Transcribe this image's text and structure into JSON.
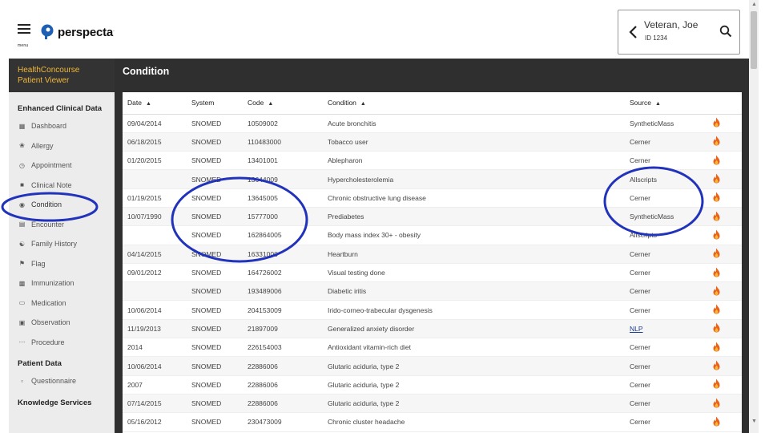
{
  "header": {
    "menu_label": "menu",
    "logo_text": "perspecta",
    "logo_mark": ".",
    "patient_name": "Veteran, Joe",
    "patient_id": "ID 1234"
  },
  "sidebar": {
    "app_title_line1": "HealthConcourse",
    "app_title_line2": "Patient Viewer",
    "section_clinical": "Enhanced Clinical Data",
    "items": [
      {
        "label": "Dashboard",
        "icon": "dashboard-icon"
      },
      {
        "label": "Allergy",
        "icon": "allergy-icon"
      },
      {
        "label": "Appointment",
        "icon": "clock-icon"
      },
      {
        "label": "Clinical Note",
        "icon": "note-icon"
      },
      {
        "label": "Condition",
        "icon": "condition-icon"
      },
      {
        "label": "Encounter",
        "icon": "encounter-icon"
      },
      {
        "label": "Family History",
        "icon": "family-icon"
      },
      {
        "label": "Flag",
        "icon": "flag-icon"
      },
      {
        "label": "Immunization",
        "icon": "immunization-icon"
      },
      {
        "label": "Medication",
        "icon": "medication-icon"
      },
      {
        "label": "Observation",
        "icon": "observation-icon"
      },
      {
        "label": "Procedure",
        "icon": "procedure-icon"
      }
    ],
    "section_patient": "Patient Data",
    "patient_items": [
      {
        "label": "Questionnaire",
        "icon": "questionnaire-icon"
      }
    ],
    "section_knowledge": "Knowledge Services"
  },
  "main": {
    "title": "Condition",
    "columns": [
      "Date",
      "System",
      "Code",
      "Condition",
      "Source"
    ],
    "rows": [
      {
        "date": "09/04/2014",
        "system": "SNOMED",
        "code": "10509002",
        "condition": "Acute bronchitis",
        "source": "SyntheticMass"
      },
      {
        "date": "06/18/2015",
        "system": "SNOMED",
        "code": "110483000",
        "condition": "Tobacco user",
        "source": "Cerner"
      },
      {
        "date": "01/20/2015",
        "system": "SNOMED",
        "code": "13401001",
        "condition": "Ablepharon",
        "source": "Cerner"
      },
      {
        "date": "",
        "system": "SNOMED",
        "code": "13644009",
        "condition": "Hypercholesterolemia",
        "source": "Allscripts"
      },
      {
        "date": "01/19/2015",
        "system": "SNOMED",
        "code": "13645005",
        "condition": "Chronic obstructive lung disease",
        "source": "Cerner"
      },
      {
        "date": "10/07/1990",
        "system": "SNOMED",
        "code": "15777000",
        "condition": "Prediabetes",
        "source": "SyntheticMass"
      },
      {
        "date": "",
        "system": "SNOMED",
        "code": "162864005",
        "condition": "Body mass index 30+ - obesity",
        "source": "Allscripts"
      },
      {
        "date": "04/14/2015",
        "system": "SNOMED",
        "code": "16331000",
        "condition": "Heartburn",
        "source": "Cerner"
      },
      {
        "date": "09/01/2012",
        "system": "SNOMED",
        "code": "164726002",
        "condition": "Visual testing done",
        "source": "Cerner"
      },
      {
        "date": "",
        "system": "SNOMED",
        "code": "193489006",
        "condition": "Diabetic iritis",
        "source": "Cerner"
      },
      {
        "date": "10/06/2014",
        "system": "SNOMED",
        "code": "204153009",
        "condition": "Irido-corneo-trabecular dysgenesis",
        "source": "Cerner"
      },
      {
        "date": "11/19/2013",
        "system": "SNOMED",
        "code": "21897009",
        "condition": "Generalized anxiety disorder",
        "source": "NLP"
      },
      {
        "date": "2014",
        "system": "SNOMED",
        "code": "226154003",
        "condition": "Antioxidant vitamin-rich diet",
        "source": "Cerner"
      },
      {
        "date": "10/06/2014",
        "system": "SNOMED",
        "code": "22886006",
        "condition": "Glutaric aciduria, type 2",
        "source": "Cerner"
      },
      {
        "date": "2007",
        "system": "SNOMED",
        "code": "22886006",
        "condition": "Glutaric aciduria, type 2",
        "source": "Cerner"
      },
      {
        "date": "07/14/2015",
        "system": "SNOMED",
        "code": "22886006",
        "condition": "Glutaric aciduria, type 2",
        "source": "Cerner"
      },
      {
        "date": "05/16/2012",
        "system": "SNOMED",
        "code": "230473009",
        "condition": "Chronic cluster headache",
        "source": "Cerner"
      }
    ]
  },
  "colors": {
    "accent": "#f0b838",
    "annotation": "#2233bb",
    "header_dark": "#2f2f2f",
    "fire": "#e8621c"
  }
}
